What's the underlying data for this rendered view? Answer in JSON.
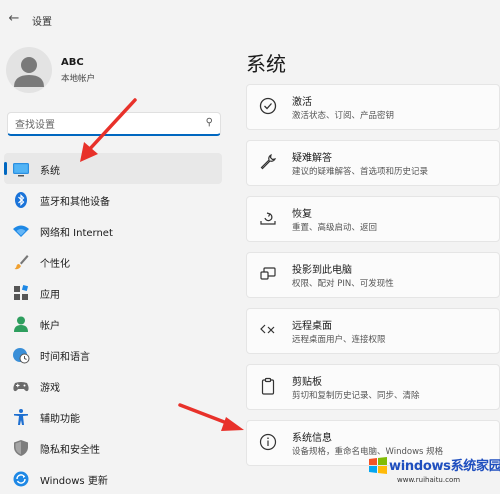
{
  "app": {
    "title": "设置",
    "back_glyph": "←"
  },
  "profile": {
    "name": "ABC",
    "subtitle": "本地帐户"
  },
  "search": {
    "placeholder": "查找设置",
    "icon": "search-icon"
  },
  "nav": {
    "items": [
      {
        "label": "系统",
        "icon": "monitor-icon",
        "active": true
      },
      {
        "label": "蓝牙和其他设备",
        "icon": "bluetooth-icon"
      },
      {
        "label": "网络和 Internet",
        "icon": "wifi-icon"
      },
      {
        "label": "个性化",
        "icon": "brush-icon"
      },
      {
        "label": "应用",
        "icon": "apps-icon"
      },
      {
        "label": "帐户",
        "icon": "person-icon"
      },
      {
        "label": "时间和语言",
        "icon": "globe-clock-icon"
      },
      {
        "label": "游戏",
        "icon": "gamepad-icon"
      },
      {
        "label": "辅助功能",
        "icon": "accessibility-icon"
      },
      {
        "label": "隐私和安全性",
        "icon": "shield-icon"
      },
      {
        "label": "Windows 更新",
        "icon": "update-icon"
      }
    ]
  },
  "main": {
    "title": "系统",
    "cards": [
      {
        "title": "激活",
        "desc": "激活状态、订阅、产品密钥",
        "icon": "check-circle-icon"
      },
      {
        "title": "疑难解答",
        "desc": "建议的疑难解答、首选项和历史记录",
        "icon": "wrench-icon"
      },
      {
        "title": "恢复",
        "desc": "重置、高级启动、返回",
        "icon": "recovery-icon"
      },
      {
        "title": "投影到此电脑",
        "desc": "权限、配对 PIN、可发现性",
        "icon": "project-icon"
      },
      {
        "title": "远程桌面",
        "desc": "远程桌面用户、连接权限",
        "icon": "remote-desktop-icon"
      },
      {
        "title": "剪贴板",
        "desc": "剪切和复制历史记录、同步、清除",
        "icon": "clipboard-icon"
      },
      {
        "title": "系统信息",
        "desc": "设备规格，重命名电脑、Windows 规格",
        "icon": "info-icon"
      }
    ]
  },
  "watermark": {
    "brand": "windows系统家园",
    "url": "www.ruihaitu.com"
  },
  "colors": {
    "accent": "#0067c0",
    "annotation_arrow": "#e8312a",
    "background": "#f3f3f3"
  }
}
